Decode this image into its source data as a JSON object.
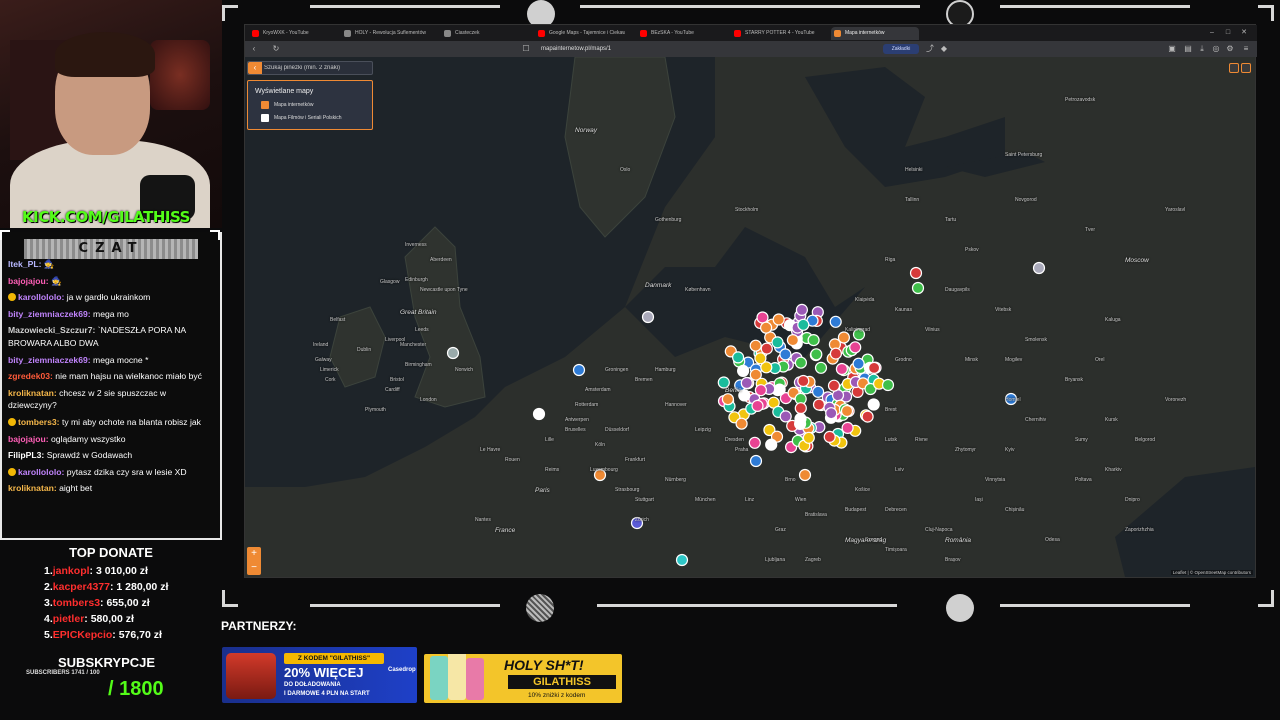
{
  "stream": {
    "kick_handle": "KICK.COM/GILATHISS",
    "chat_title": "CZAT",
    "chat_messages": [
      {
        "user": "Itek_PL:",
        "text": "🧙",
        "color": "#b8b8ff",
        "badge": false
      },
      {
        "user": "bajojajou:",
        "text": "🧙",
        "color": "#ff5fb7",
        "badge": false
      },
      {
        "user": "karollololo:",
        "text": "ja w gardło ukrainkom",
        "color": "#c084fc",
        "badge": true
      },
      {
        "user": "bity_ziemniaczek69:",
        "text": "mega mo",
        "color": "#c084fc",
        "badge": false
      },
      {
        "user": "Mazowiecki_Szczur7:",
        "text": "`NADESZŁA PORA NA BROWARA ALBO DWA",
        "color": "#d0d0d0",
        "badge": false
      },
      {
        "user": "bity_ziemniaczek69:",
        "text": "mega mocne *",
        "color": "#c084fc",
        "badge": false
      },
      {
        "user": "zgredek03:",
        "text": "nie mam hajsu na wielkanoc miało być",
        "color": "#ff5b3a",
        "badge": false
      },
      {
        "user": "kroliknatan:",
        "text": "chcesz w 2 sie spuszczac w dziewczyny?",
        "color": "#f5b74a",
        "badge": false
      },
      {
        "user": "tombers3:",
        "text": "ty mi aby ochote na blanta robisz jak",
        "color": "#f5b74a",
        "badge": true
      },
      {
        "user": "bajojajou:",
        "text": "oglądamy wszystko",
        "color": "#ff5fb7",
        "badge": false
      },
      {
        "user": "FilipPL3:",
        "text": "Sprawdź w Godawach",
        "color": "#ffffff",
        "badge": false
      },
      {
        "user": "karollololo:",
        "text": "pytasz dzika czy sra w lesie XD",
        "color": "#c084fc",
        "badge": true
      },
      {
        "user": "kroliknatan:",
        "text": "aight bet",
        "color": "#f5b74a",
        "badge": false
      }
    ],
    "top_donate": {
      "title": "TOP DONATE",
      "entries": [
        {
          "rank": "1.",
          "name": "jankopl",
          "amount": ": 3 010,00 zł"
        },
        {
          "rank": "2.",
          "name": "kacper4377",
          "amount": ": 1 280,00 zł"
        },
        {
          "rank": "3.",
          "name": "tombers3",
          "amount": ": 655,00 zł"
        },
        {
          "rank": "4.",
          "name": "pietler",
          "amount": ": 580,00 zł"
        },
        {
          "rank": "5.",
          "name": "EPICKepcio",
          "amount": ": 576,70 zł"
        }
      ]
    },
    "subs_title": "SUBSKRYPCJE",
    "subs_small": "SUBSCRIBERS 1741 / 100",
    "subs_goal": "/ 1800",
    "partners_title": "PARTNERZY:",
    "casedrop": {
      "code": "Z KODEM \"GILATHISS\"",
      "percent": "20% WIĘCEJ",
      "line2": "DO DOŁADOWANIA",
      "line3": "I DARMOWE 4 PLN NA START",
      "brand": "Casedrop"
    },
    "holyshot": {
      "title": "HOLY SH*T!",
      "code": "GILATHISS",
      "sub": "10% zniżki z kodem"
    }
  },
  "browser": {
    "tabs": [
      {
        "label": "KryoWXK - YouTube",
        "icon_color": "#ff0000",
        "active": false
      },
      {
        "label": "HOLY - Rewolucja Suflementów",
        "icon_color": "#888888",
        "active": false
      },
      {
        "label": "Ciasteczek",
        "icon_color": "#888888",
        "active": false
      },
      {
        "label": "Google Maps - Tajemnice i Ciekawostki",
        "icon_color": "#ff0000",
        "active": false
      },
      {
        "label": "BEzSKA - YouTube",
        "icon_color": "#ff0000",
        "active": false
      },
      {
        "label": "STARRY POTTER 4 - YouTube",
        "icon_color": "#ff0000",
        "active": false
      },
      {
        "label": "Mapa internetków",
        "icon_color": "#ef8a34",
        "active": true
      }
    ],
    "url": "mapainternetow.pl/maps/1",
    "bookmark_label": "Zakładki"
  },
  "map": {
    "search_placeholder": "Szukaj pinezki (min. 2 znaki)",
    "layers_title": "Wyświetlane mapy",
    "layers": [
      {
        "label": "Mapa internetków",
        "checked": true
      },
      {
        "label": "Mapa Filmów i Seriali Polskich",
        "checked": false
      }
    ],
    "zoom_in": "+",
    "zoom_out": "−",
    "attribution": "Leaflet | © OpenStreetMap contributors",
    "labels": {
      "great_britain": "Great Britain",
      "ireland": "Ireland",
      "dublin": "Dublin",
      "edinburgh": "Edinburgh",
      "glasgow": "Glasgow",
      "newcastle": "Newcastle upon Tyne",
      "manchester": "Manchester",
      "birmingham": "Birmingham",
      "london": "London",
      "belfast": "Belfast",
      "cork": "Cork",
      "cardiff": "Cardiff",
      "norway": "Norway",
      "oslo": "Oslo",
      "stockholm": "Stockholm",
      "helsinki": "Helsinki",
      "tallinn": "Tallinn",
      "riga": "Riga",
      "st_petersburg": "Saint Petersburg",
      "petrozavodsk": "Petrozavodsk",
      "gothenburg": "Gothenburg",
      "denmark": "Danmark",
      "copenhagen": "København",
      "vilnius": "Vilnius",
      "minsk": "Minsk",
      "moscow": "Moscow",
      "tver": "Tver",
      "smolensk": "Smolensk",
      "bryansk": "Bryansk",
      "kursk": "Kursk",
      "kyiv": "Kyiv",
      "kharkiv": "Kharkiv",
      "hamburg": "Hamburg",
      "amsterdam": "Amsterdam",
      "berlin": "Berlin",
      "brussels": "Bruxelles",
      "paris": "Paris",
      "france": "France",
      "frankfurt": "Frankfurt",
      "munich": "München",
      "prague": "Praha",
      "vienna": "Wien",
      "budapest": "Budapest",
      "bratislava": "Bratislava",
      "zurich": "Zürich",
      "magyarorszag": "Magyarország",
      "romania": "România",
      "chisinau": "Chișinău",
      "odesa": "Odesa",
      "dnipro": "Dnipro",
      "zaporizhzhia": "Zaporizhzhia",
      "lviv": "Lviv",
      "cluj": "Cluj-Napoca",
      "bremen": "Bremen",
      "dusseldorf": "Düsseldorf",
      "lille": "Lille",
      "brest": "Brest",
      "gomel": "Homiel",
      "kaliningrad": "Kaliningrad",
      "klaipeda": "Klaipėda",
      "tartu": "Tartu",
      "pskov": "Pskov",
      "novgorod": "Novgorod",
      "yaroslavl": "Yaroslavl",
      "kaluga": "Kaluga",
      "orel": "Orel",
      "voronezh": "Voronezh",
      "belgorod": "Belgorod",
      "sumy": "Sumy",
      "poltava": "Poltava",
      "vinnytsia": "Vinnytsia",
      "zhytomyr": "Zhytomyr",
      "rivne": "Rivne",
      "lutsk": "Lutsk",
      "chernihiv": "Chernihiv",
      "mogilev": "Mogilev",
      "vitebsk": "Vitebsk",
      "grodno": "Grodno",
      "kaunas": "Kaunas",
      "daugavpils": "Daugavpils",
      "leipzig": "Leipzig",
      "dresden": "Dresden",
      "nurnberg": "Nürnberg",
      "stuttgart": "Stuttgart",
      "koln": "Köln",
      "hannover": "Hannover",
      "graz": "Graz",
      "linz": "Linz",
      "brno": "Brno",
      "kosice": "Košice",
      "debrecen": "Debrecen",
      "szeged": "Szeged",
      "timisoara": "Timișoara",
      "iasi": "Iași",
      "brasov": "Brașov",
      "groningen": "Groningen",
      "rotterdam": "Rotterdam",
      "antwerpen": "Antwerpen",
      "luxembourg": "Luxembourg",
      "strasbourg": "Strasbourg",
      "reims": "Reims",
      "rouen": "Rouen",
      "nantes": "Nantes",
      "le_havre": "Le Havre",
      "ljubljana": "Ljubljana",
      "zagreb": "Zagreb",
      "aberdeen": "Aberdeen",
      "inverness": "Inverness",
      "norwich": "Norwich",
      "plymouth": "Plymouth",
      "bristol": "Bristol",
      "leeds": "Leeds",
      "liverpool": "Liverpool",
      "galway": "Galway",
      "limerick": "Limerick"
    }
  },
  "colors": {
    "accent": "#ef8a34",
    "kick_green": "#53fc18",
    "donor_red": "#ff2e2e",
    "map_land": "#2c2f2c",
    "map_sea": "#1e2429"
  }
}
